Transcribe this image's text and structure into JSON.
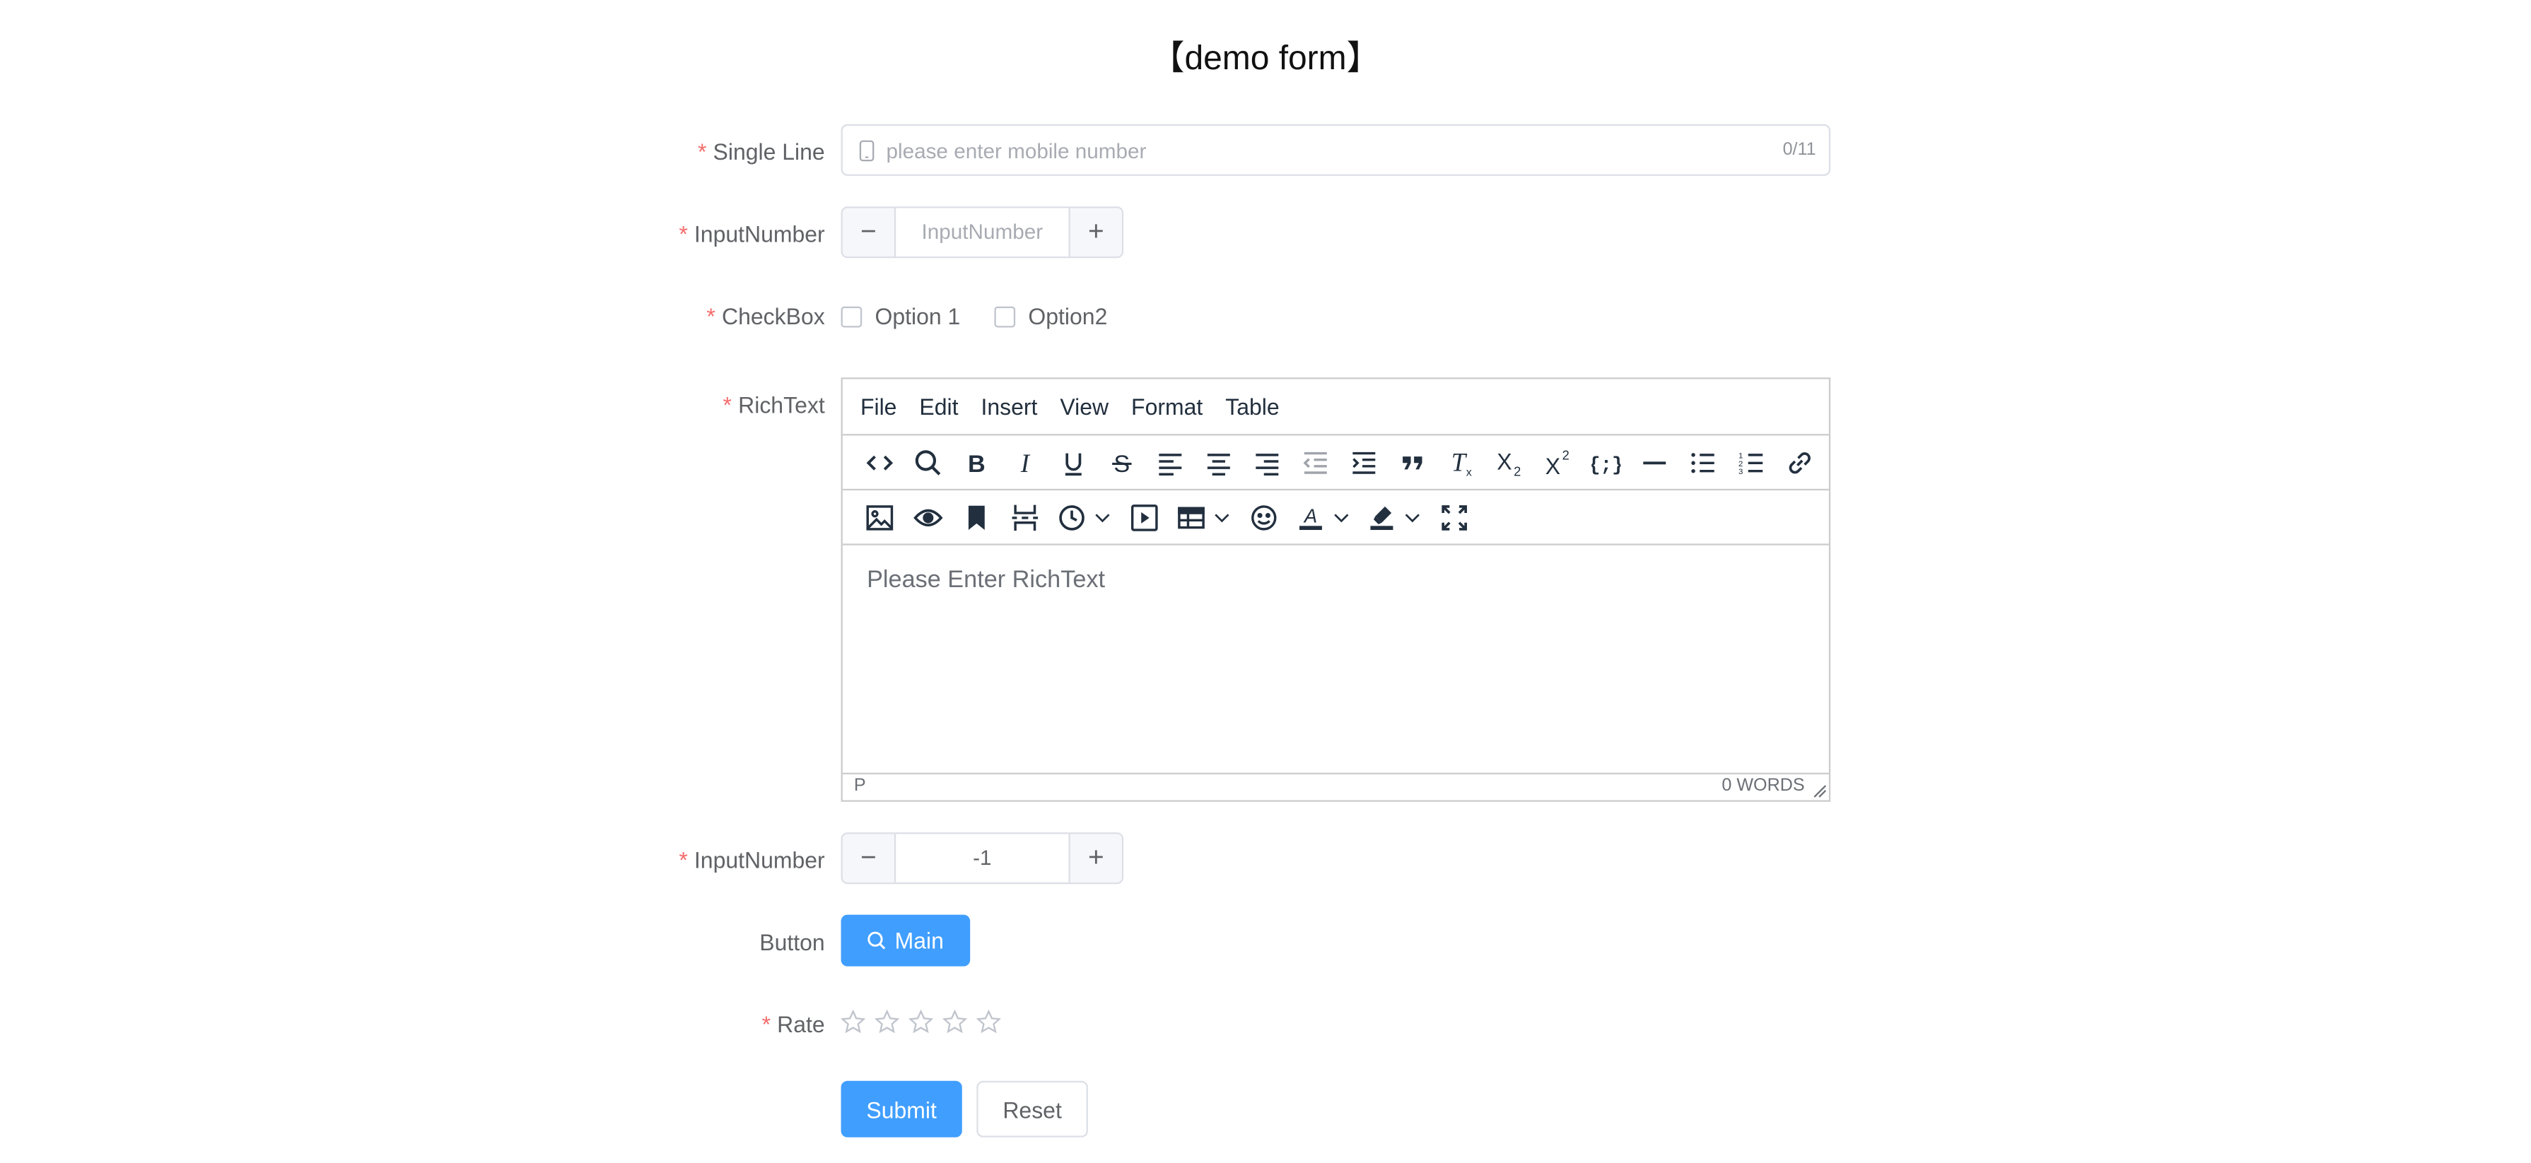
{
  "form": {
    "title": "【demo form】"
  },
  "single_line": {
    "label": "Single Line",
    "placeholder": "please enter mobile number",
    "counter": "0/11"
  },
  "input_number_1": {
    "label": "InputNumber",
    "placeholder": "InputNumber",
    "value": ""
  },
  "checkbox": {
    "label": "CheckBox",
    "options": [
      {
        "label": "Option 1",
        "checked": false
      },
      {
        "label": "Option2",
        "checked": false
      }
    ]
  },
  "richtext": {
    "label": "RichText",
    "menu": [
      "File",
      "Edit",
      "Insert",
      "View",
      "Format",
      "Table"
    ],
    "toolbar_row1_icons": [
      "code-icon",
      "search-icon",
      "bold-icon",
      "italic-icon",
      "underline-icon",
      "strikethrough-icon",
      "align-left-icon",
      "align-center-icon",
      "align-right-icon",
      "outdent-icon",
      "indent-icon",
      "blockquote-icon",
      "remove-format-icon",
      "subscript-icon",
      "superscript-icon",
      "code-sample-icon",
      "horizontal-rule-icon",
      "bullet-list-icon",
      "numbered-list-icon",
      "link-icon"
    ],
    "toolbar_row2_icons": [
      "image-icon",
      "preview-icon",
      "bookmark-icon",
      "page-break-icon",
      "insert-time-icon",
      "media-icon",
      "table-icon",
      "emoticons-icon",
      "text-color-icon",
      "highlight-icon",
      "fullscreen-icon"
    ],
    "placeholder": "Please Enter RichText",
    "status_path": "P",
    "word_count": "0 WORDS"
  },
  "input_number_2": {
    "label": "InputNumber",
    "value": "-1"
  },
  "button_field": {
    "label": "Button",
    "button_label": "Main",
    "icon": "search-icon"
  },
  "rate": {
    "label": "Rate",
    "value": 0,
    "max": 5
  },
  "actions": {
    "submit": "Submit",
    "reset": "Reset"
  },
  "colors": {
    "primary": "#409eff",
    "required": "#f56c6c",
    "border": "#dcdfe6"
  }
}
